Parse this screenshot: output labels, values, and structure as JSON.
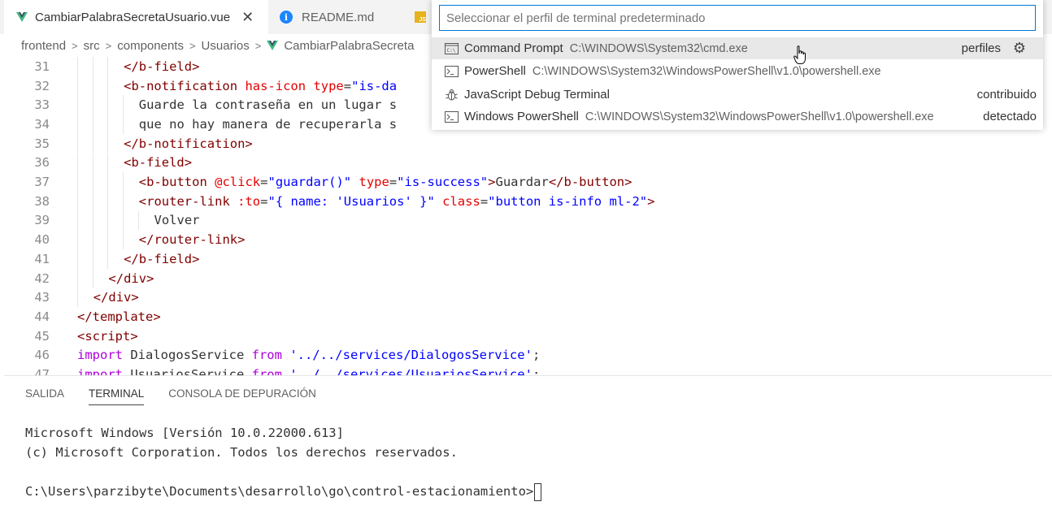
{
  "tabs": [
    {
      "label": "CambiarPalabraSecretaUsuario.vue",
      "icon": "vue-icon"
    },
    {
      "label": "README.md",
      "icon": "info-icon"
    },
    {
      "label": "",
      "icon": "js-icon"
    }
  ],
  "breadcrumb": [
    "frontend",
    "src",
    "components",
    "Usuarios",
    "CambiarPalabraSecreta"
  ],
  "quickpick": {
    "placeholder": "Seleccionar el perfil de terminal predeterminado",
    "items": [
      {
        "name": "Command Prompt",
        "path": "C:\\WINDOWS\\System32\\cmd.exe",
        "group": "perfiles",
        "icon": "cmd-icon"
      },
      {
        "name": "PowerShell",
        "path": "C:\\WINDOWS\\System32\\WindowsPowerShell\\v1.0\\powershell.exe",
        "group": "",
        "icon": "terminal-icon"
      },
      {
        "name": "JavaScript Debug Terminal",
        "path": "",
        "group": "contribuido",
        "icon": "bug-icon"
      },
      {
        "name": "Windows PowerShell",
        "path": "C:\\WINDOWS\\System32\\WindowsPowerShell\\v1.0\\powershell.exe",
        "group": "detectado",
        "icon": "terminal-icon"
      }
    ]
  },
  "editor": {
    "lines": [
      {
        "n": "31",
        "segs": [
          [
            "p",
            "</"
          ],
          [
            "tag",
            "b-field"
          ],
          [
            "p",
            ">"
          ]
        ],
        "indent": 3
      },
      {
        "n": "32",
        "segs": [
          [
            "p",
            "<"
          ],
          [
            "tag",
            "b-notification"
          ],
          [
            "txt",
            " "
          ],
          [
            "attr",
            "has-icon"
          ],
          [
            "txt",
            " "
          ],
          [
            "attr",
            "type"
          ],
          [
            "txt",
            "="
          ],
          [
            "str",
            "\"is-da"
          ]
        ],
        "indent": 3
      },
      {
        "n": "33",
        "segs": [
          [
            "txt",
            "Guarde la contraseña en un lugar s"
          ]
        ],
        "indent": 4
      },
      {
        "n": "34",
        "segs": [
          [
            "txt",
            "que no hay manera de recuperarla s"
          ]
        ],
        "indent": 4
      },
      {
        "n": "35",
        "segs": [
          [
            "p",
            "</"
          ],
          [
            "tag",
            "b-notification"
          ],
          [
            "p",
            ">"
          ]
        ],
        "indent": 3
      },
      {
        "n": "36",
        "segs": [
          [
            "p",
            "<"
          ],
          [
            "tag",
            "b-field"
          ],
          [
            "p",
            ">"
          ]
        ],
        "indent": 3
      },
      {
        "n": "37",
        "segs": [
          [
            "p",
            "<"
          ],
          [
            "tag",
            "b-button"
          ],
          [
            "txt",
            " "
          ],
          [
            "attr",
            "@click"
          ],
          [
            "txt",
            "="
          ],
          [
            "str",
            "\"guardar()\""
          ],
          [
            "txt",
            " "
          ],
          [
            "attr",
            "type"
          ],
          [
            "txt",
            "="
          ],
          [
            "str",
            "\"is-success\""
          ],
          [
            "p",
            ">"
          ],
          [
            "txt",
            "Guardar"
          ],
          [
            "p",
            "</"
          ],
          [
            "tag",
            "b-button"
          ],
          [
            "p",
            ">"
          ]
        ],
        "indent": 4
      },
      {
        "n": "38",
        "segs": [
          [
            "p",
            "<"
          ],
          [
            "tag",
            "router-link"
          ],
          [
            "txt",
            " "
          ],
          [
            "attr",
            ":to"
          ],
          [
            "txt",
            "="
          ],
          [
            "str",
            "\"{ name: 'Usuarios' }\""
          ],
          [
            "txt",
            " "
          ],
          [
            "attr",
            "class"
          ],
          [
            "txt",
            "="
          ],
          [
            "str",
            "\"button is-info ml-2\""
          ],
          [
            "p",
            ">"
          ]
        ],
        "indent": 4
      },
      {
        "n": "39",
        "segs": [
          [
            "txt",
            "Volver"
          ]
        ],
        "indent": 5
      },
      {
        "n": "40",
        "segs": [
          [
            "p",
            "</"
          ],
          [
            "tag",
            "router-link"
          ],
          [
            "p",
            ">"
          ]
        ],
        "indent": 4
      },
      {
        "n": "41",
        "segs": [
          [
            "p",
            "</"
          ],
          [
            "tag",
            "b-field"
          ],
          [
            "p",
            ">"
          ]
        ],
        "indent": 3
      },
      {
        "n": "42",
        "segs": [
          [
            "p",
            "</"
          ],
          [
            "tag",
            "div"
          ],
          [
            "p",
            ">"
          ]
        ],
        "indent": 2
      },
      {
        "n": "43",
        "segs": [
          [
            "p",
            "</"
          ],
          [
            "tag",
            "div"
          ],
          [
            "p",
            ">"
          ]
        ],
        "indent": 1
      },
      {
        "n": "44",
        "segs": [
          [
            "p",
            "</"
          ],
          [
            "tag",
            "template"
          ],
          [
            "p",
            ">"
          ]
        ],
        "indent": 0
      },
      {
        "n": "45",
        "segs": [
          [
            "p",
            "<"
          ],
          [
            "tag",
            "script"
          ],
          [
            "p",
            ">"
          ]
        ],
        "indent": 0
      },
      {
        "n": "46",
        "segs": [
          [
            "kw",
            "import"
          ],
          [
            "txt",
            " DialogosService "
          ],
          [
            "kw",
            "from"
          ],
          [
            "txt",
            " "
          ],
          [
            "str",
            "'../../services/DialogosService'"
          ],
          [
            "txt",
            ";"
          ]
        ],
        "indent": 0
      },
      {
        "n": "47",
        "segs": [
          [
            "kw",
            "import"
          ],
          [
            "txt",
            " UsuariosService "
          ],
          [
            "kw",
            "from"
          ],
          [
            "txt",
            " "
          ],
          [
            "str",
            "'../../services/UsuariosService'"
          ],
          [
            "txt",
            ";"
          ]
        ],
        "indent": 0
      }
    ]
  },
  "panel": {
    "tabs": [
      "SALIDA",
      "TERMINAL",
      "CONSOLA DE DEPURACIÓN"
    ],
    "active_tab": "TERMINAL",
    "terminal_lines": [
      "Microsoft Windows [Versión 10.0.22000.613]",
      "(c) Microsoft Corporation. Todos los derechos reservados.",
      "",
      "C:\\Users\\parzibyte\\Documents\\desarrollo\\go\\control-estacionamiento>"
    ]
  },
  "colors": {
    "accent": "#0078d4",
    "vue": "#41b883",
    "tag": "#800000",
    "attr": "#e50000",
    "string": "#0000ff",
    "keyword": "#af00db"
  }
}
